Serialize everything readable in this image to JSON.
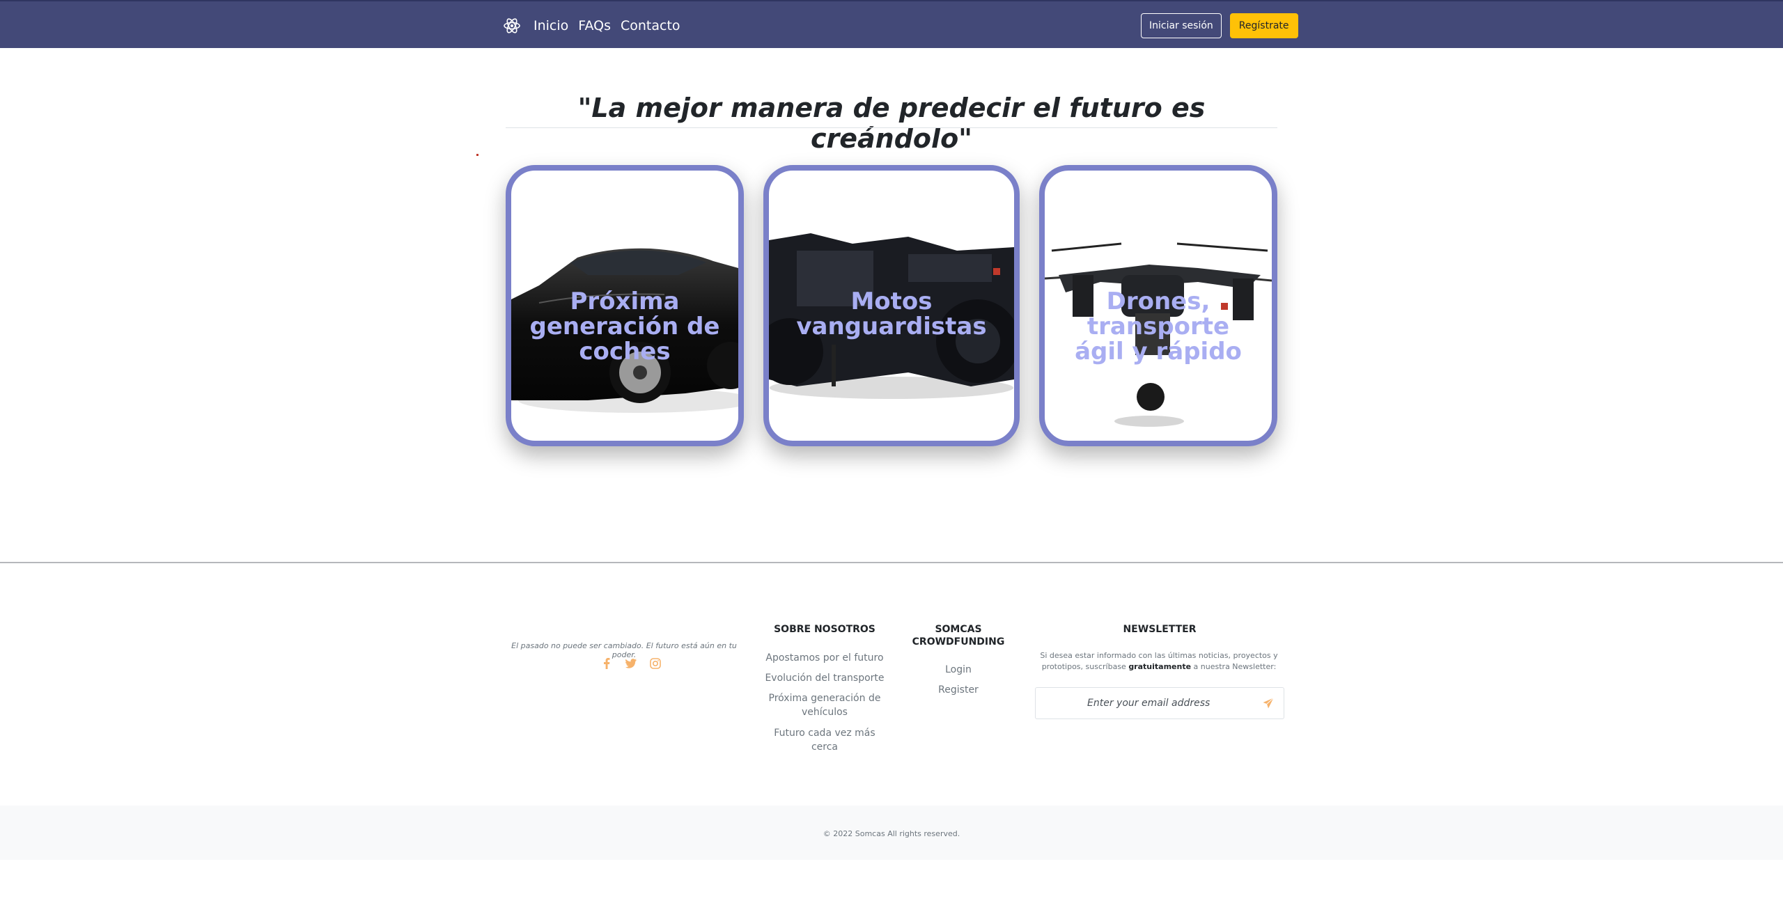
{
  "nav": {
    "links": [
      "Inicio",
      "FAQs",
      "Contacto"
    ],
    "login_label": "Iniciar sesión",
    "register_label": "Regístrate"
  },
  "hero": {
    "quote": "\"La mejor manera de predecir el futuro es creándolo\""
  },
  "cards": [
    {
      "title": "Próxima generación de coches",
      "image": "black-car"
    },
    {
      "title": "Motos vanguardistas",
      "image": "motorcycle"
    },
    {
      "title": "Drones, transporte ágil y rápido",
      "image": "drone"
    }
  ],
  "footer": {
    "tagline": "El pasado no puede ser cambiado. El futuro está aún en tu poder.",
    "socials": [
      "facebook-icon",
      "twitter-icon",
      "instagram-icon"
    ],
    "about": {
      "title": "SOBRE NOSOTROS",
      "links": [
        "Apostamos por el futuro",
        "Evolución del transporte",
        "Próxima generación de vehículos",
        "Futuro cada vez más cerca"
      ]
    },
    "crowdfunding": {
      "title": "SOMCAS CROWDFUNDING",
      "links": [
        "Login",
        "Register"
      ]
    },
    "newsletter": {
      "title": "NEWSLETTER",
      "text_before": "Si desea estar informado con las últimas noticias, proyectos y prototipos, suscríbase ",
      "text_bold": "gratuitamente",
      "text_after": " a nuestra Newsletter:",
      "placeholder": "Enter your email address"
    },
    "copyright": "© 2022 Somcas All rights reserved."
  },
  "colors": {
    "navbar": "#434978",
    "accent": "#ffc107",
    "card_border": "#7a80c9",
    "card_title": "#a9aef2",
    "social_icon": "#f6b26b"
  }
}
